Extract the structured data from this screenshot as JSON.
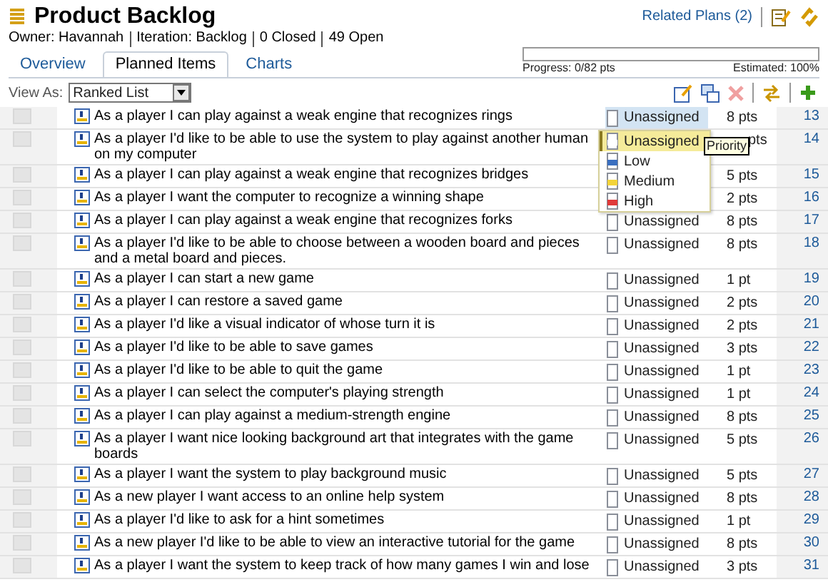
{
  "header": {
    "title": "Product Backlog",
    "related_link": "Related Plans (2)",
    "meta": [
      "Owner: Havannah",
      "Iteration: Backlog",
      "0 Closed",
      "49 Open"
    ]
  },
  "tabs": [
    {
      "label": "Overview",
      "selected": false
    },
    {
      "label": "Planned Items",
      "selected": true
    },
    {
      "label": "Charts",
      "selected": false
    }
  ],
  "progress": {
    "level": 0,
    "label": "Progress: 0/82 pts",
    "estimate": "Estimated: 100%"
  },
  "view_as": {
    "label": "View As:",
    "value": "Ranked List"
  },
  "rows": [
    {
      "summary": "As a player I can play against a weak engine that recognizes rings",
      "priority": "Unassigned",
      "points": "8 pts",
      "rank": "13",
      "highlighted": true
    },
    {
      "summary": "As a player I'd like to be able to use the system to play against another human on my computer",
      "points": "pts",
      "rank": "14"
    },
    {
      "summary": "As a player I can play against a weak engine that recognizes bridges",
      "points": "5 pts",
      "rank": "15"
    },
    {
      "summary": "As a player I want the computer to recognize a winning shape",
      "points": "2 pts",
      "rank": "16"
    },
    {
      "summary": "As a player I can play against a weak engine that recognizes forks",
      "priority": "Unassigned",
      "points": "8 pts",
      "rank": "17"
    },
    {
      "summary": "As a player I'd like to be able to choose between a wooden board and pieces and a metal board and pieces.",
      "priority": "Unassigned",
      "points": "8 pts",
      "rank": "18"
    },
    {
      "summary": "As a player I can start a new game",
      "priority": "Unassigned",
      "points": "1 pt",
      "rank": "19"
    },
    {
      "summary": "As a player I can restore a saved game",
      "priority": "Unassigned",
      "points": "2 pts",
      "rank": "20"
    },
    {
      "summary": "As a player I'd like a visual indicator of whose turn it is",
      "priority": "Unassigned",
      "points": "2 pts",
      "rank": "21"
    },
    {
      "summary": "As a player I'd like to be able to save games",
      "priority": "Unassigned",
      "points": "3 pts",
      "rank": "22"
    },
    {
      "summary": "As a player I'd like to be able to quit the game",
      "priority": "Unassigned",
      "points": "1 pt",
      "rank": "23"
    },
    {
      "summary": "As a player I can select the computer's playing strength",
      "priority": "Unassigned",
      "points": "1 pt",
      "rank": "24"
    },
    {
      "summary": "As a player I can play against a medium-strength engine",
      "priority": "Unassigned",
      "points": "8 pts",
      "rank": "25"
    },
    {
      "summary": "As a player I want nice looking background art that integrates with the game boards",
      "priority": "Unassigned",
      "points": "5 pts",
      "rank": "26"
    },
    {
      "summary": "As a player I want the system to play background music",
      "priority": "Unassigned",
      "points": "5 pts",
      "rank": "27"
    },
    {
      "summary": "As a new player I want access to an online help system",
      "priority": "Unassigned",
      "points": "8 pts",
      "rank": "28"
    },
    {
      "summary": "As a player I'd like to ask for a hint sometimes",
      "priority": "Unassigned",
      "points": "1 pt",
      "rank": "29"
    },
    {
      "summary": "As a new player I'd like to be able to view an interactive tutorial for the game",
      "priority": "Unassigned",
      "points": "8 pts",
      "rank": "30"
    },
    {
      "summary": "As a player I want the system to keep track of how many games I win and lose",
      "priority": "Unassigned",
      "points": "3 pts",
      "rank": "31"
    }
  ],
  "priority_menu": {
    "options": [
      {
        "label": "Unassigned",
        "selected": true,
        "color": "#ffffff"
      },
      {
        "label": "Low",
        "selected": false,
        "color": "#3a6fc0"
      },
      {
        "label": "Medium",
        "selected": false,
        "color": "#f2d33a"
      },
      {
        "label": "High",
        "selected": false,
        "color": "#e03a3a"
      }
    ],
    "tooltip": "Priority"
  }
}
